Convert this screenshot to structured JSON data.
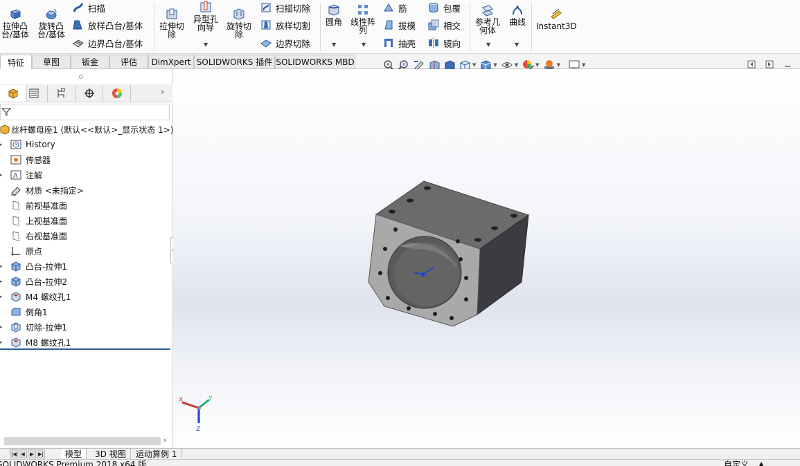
{
  "ribbon": {
    "extrude_boss": "拉伸凸\n台/基体",
    "revolve_boss": "旋转凸\n台/基体",
    "sweep": "扫描",
    "loft_boss": "放样凸台/基体",
    "boundary_boss": "边界凸台/基体",
    "extrude_cut": "拉伸切\n除",
    "hole_wizard": "异型孔\n向导",
    "revolve_cut": "旋转切\n除",
    "swept_cut": "扫描切除",
    "lofted_cut": "放样切割",
    "boundary_cut": "边界切除",
    "fillet": "圆角",
    "linear_pattern": "线性阵\n列",
    "rib": "筋",
    "draft": "拔模",
    "shell": "抽壳",
    "wrap": "包覆",
    "intersect": "相交",
    "mirror": "镜向",
    "ref_geometry": "参考几\n何体",
    "curves": "曲线",
    "instant3d": "Instant3D"
  },
  "tabs": [
    "特征",
    "草图",
    "钣金",
    "评估",
    "DimXpert",
    "SOLIDWORKS 插件",
    "SOLIDWORKS MBD"
  ],
  "tree": {
    "root": "丝杆螺母座1 (默认<<默认>_显示状态 1>)",
    "items": [
      {
        "label": "History",
        "icon": "history-icon"
      },
      {
        "label": "传感器",
        "icon": "sensor-icon"
      },
      {
        "label": "注解",
        "icon": "annotation-icon"
      },
      {
        "label": "材质 <未指定>",
        "icon": "material-icon"
      },
      {
        "label": "前视基准面",
        "icon": "plane-icon"
      },
      {
        "label": "上视基准面",
        "icon": "plane-icon"
      },
      {
        "label": "右视基准面",
        "icon": "plane-icon"
      },
      {
        "label": "原点",
        "icon": "origin-icon"
      },
      {
        "label": "凸台-拉伸1",
        "icon": "boss-extrude-icon"
      },
      {
        "label": "凸台-拉伸2",
        "icon": "boss-extrude-icon"
      },
      {
        "label": "M4 螺纹孔1",
        "icon": "hole-icon"
      },
      {
        "label": "倒角1",
        "icon": "chamfer-icon"
      },
      {
        "label": "切除-拉伸1",
        "icon": "cut-extrude-icon"
      },
      {
        "label": "M8 螺纹孔1",
        "icon": "hole-icon"
      }
    ]
  },
  "bottom_tabs": [
    "模型",
    "3D 视图",
    "运动算例 1"
  ],
  "status": {
    "left": "SOLIDWORKS Premium 2018 x64 版",
    "right": "自定义"
  },
  "triad": {
    "x": "X",
    "y": "Y",
    "z": "Z"
  },
  "colors": {
    "part_face": "#6b6b6b",
    "part_front": "#a9a9a9",
    "part_side": "#3d3b42",
    "accent": "#2c5aa0"
  }
}
